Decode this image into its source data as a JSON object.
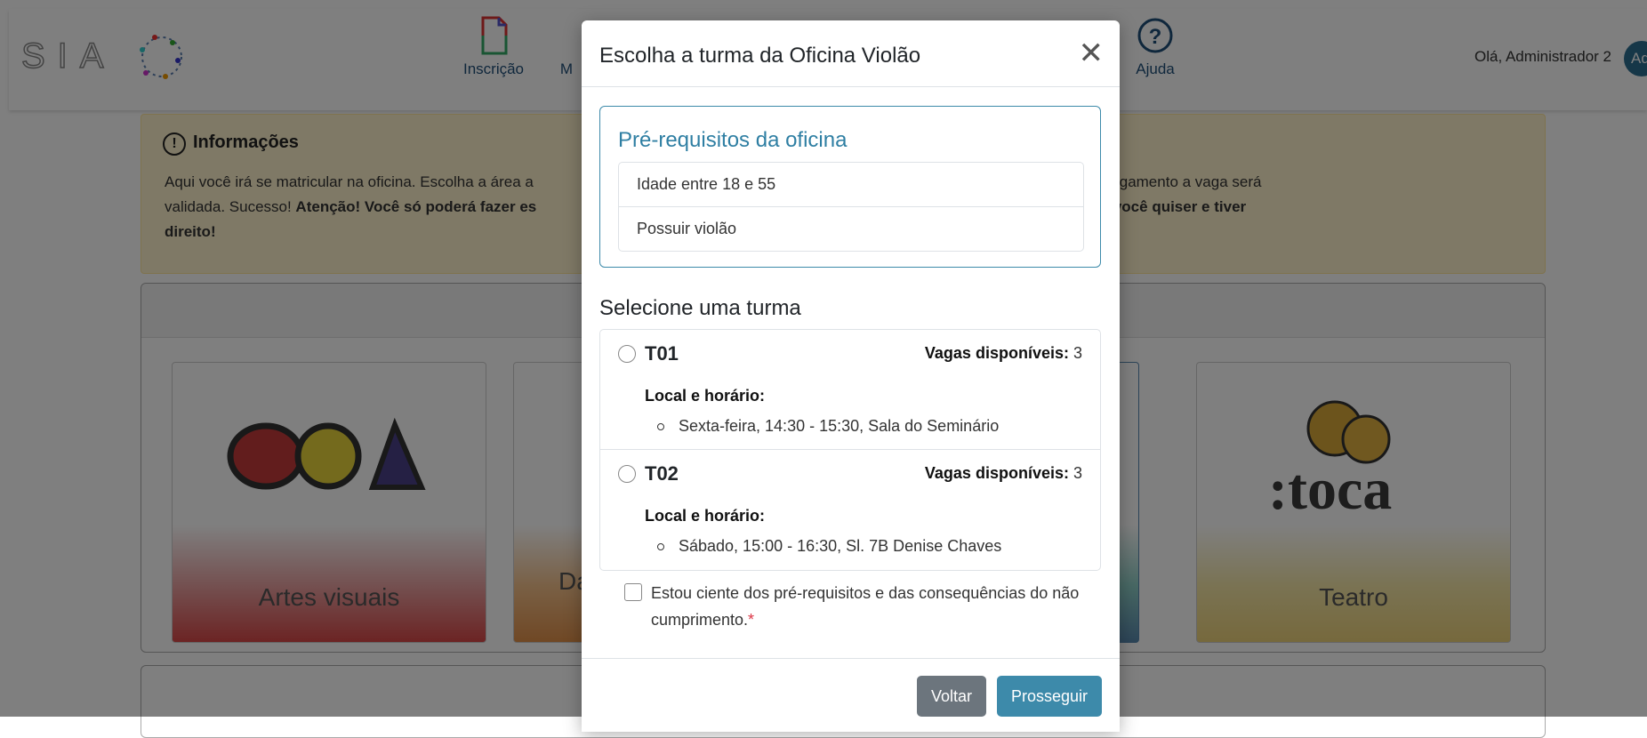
{
  "header": {
    "logo_text": "SIAC",
    "nav": [
      {
        "label": "Inscrição",
        "icon": "document-icon"
      },
      {
        "label": "M",
        "icon": "grid-icon"
      },
      {
        "label": "Ajuda",
        "icon": "help-circle-icon"
      }
    ],
    "greeting": "Olá, Administrador 2",
    "avatar_initials": "Ad"
  },
  "info": {
    "title": "Informações",
    "text_start": "Aqui você irá se matricular na oficina. Escolha a área a",
    "text_tail": "pagamento a vaga será",
    "line2_start": "validada. Sucesso! ",
    "line2_bold": "Atenção! Você só poderá fazer es",
    "line2_tail_bold": "as que você quiser e tiver",
    "line3_bold": "direito!"
  },
  "areas": [
    {
      "label": "Artes visuais",
      "logo": "OCA"
    },
    {
      "label": "Da",
      "logo": ""
    },
    {
      "label": "",
      "logo": ""
    },
    {
      "label": "Teatro",
      "logo": "toca"
    }
  ],
  "modal": {
    "title": "Escolha a turma da Oficina Violão",
    "close_icon": "close-icon",
    "prereq_title": "Pré-requisitos da oficina",
    "prereqs": [
      "Idade entre 18 e 55",
      "Possuir violão"
    ],
    "select_title": "Selecione uma turma",
    "vagas_label": "Vagas disponíveis:",
    "schedule_label": "Local e horário:",
    "turmas": [
      {
        "code": "T01",
        "vagas": "3",
        "slot": "Sexta-feira, 14:30 - 15:30, Sala do Seminário"
      },
      {
        "code": "T02",
        "vagas": "3",
        "slot": "Sábado, 15:00 - 16:30, Sl. 7B Denise Chaves"
      }
    ],
    "ack_text": "Estou ciente dos pré-requisitos e das consequências do não cumprimento.",
    "ack_required": "*",
    "back_label": "Voltar",
    "proceed_label": "Prosseguir"
  },
  "colors": {
    "accent": "#3d8aaa",
    "secondary": "#6c757d",
    "warning_bg": "#fff3cd"
  }
}
